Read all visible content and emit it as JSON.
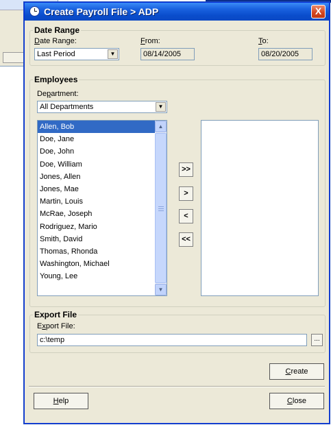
{
  "window": {
    "title": "Create Payroll File > ADP",
    "close_label": "X"
  },
  "date_range": {
    "legend": "Date Range",
    "range_label": "Date Range:",
    "range_value": "Last Period",
    "from_label": "From:",
    "from_value": "08/14/2005",
    "to_label": "To:",
    "to_value": "08/20/2005"
  },
  "employees": {
    "legend": "Employees",
    "department_label": "Department:",
    "department_value": "All Departments",
    "available": [
      "Allen, Bob",
      "Doe, Jane",
      "Doe, John",
      "Doe, William",
      "Jones, Allen",
      "Jones, Mae",
      "Martin, Louis",
      "McRae, Joseph",
      "Rodriguez, Mario",
      "Smith, David",
      "Thomas, Rhonda",
      "Washington, Michael",
      "Young, Lee"
    ],
    "selected_index": 0,
    "move_buttons": {
      "add_all": ">>",
      "add": ">",
      "remove": "<",
      "remove_all": "<<"
    }
  },
  "export": {
    "legend": "Export File",
    "file_label": "Export File:",
    "file_value": "c:\\temp",
    "browse_label": "..."
  },
  "buttons": {
    "create": "Create",
    "help": "Help",
    "close": "Close"
  },
  "colors": {
    "title_bar": "#0a4dcc",
    "selection": "#316ac5",
    "dialog_bg": "#ece9d8"
  }
}
